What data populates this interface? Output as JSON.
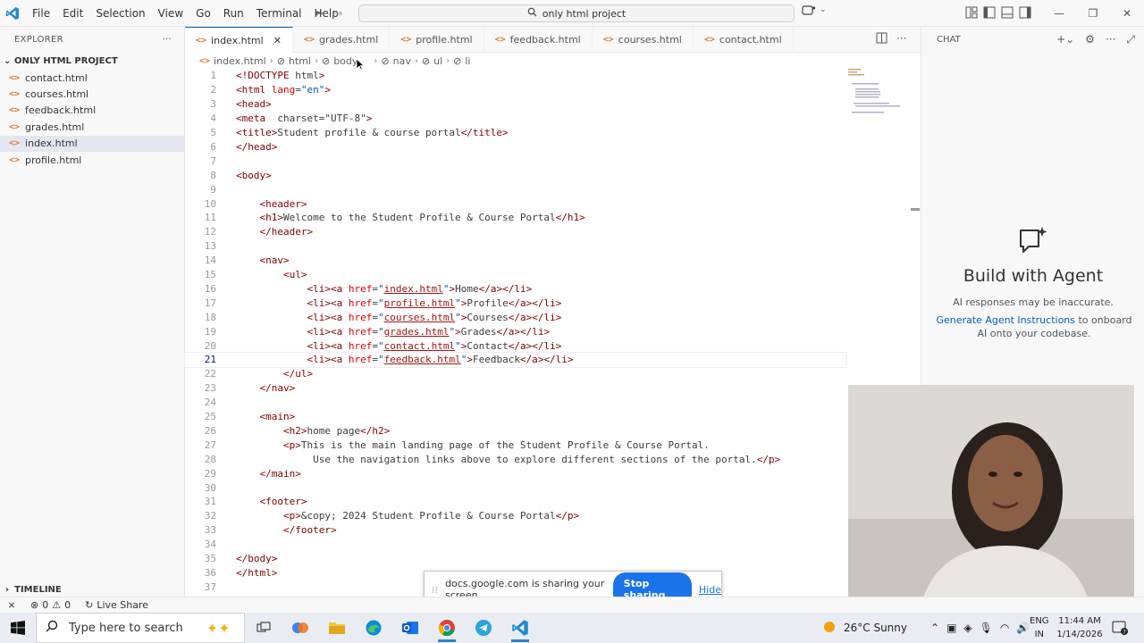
{
  "titlebar": {
    "menu": [
      "File",
      "Edit",
      "Selection",
      "View",
      "Go",
      "Run",
      "Terminal",
      "Help"
    ],
    "search": "only html project"
  },
  "explorer": {
    "header": "EXPLORER",
    "folder": "ONLY HTML PROJECT",
    "files": [
      "contact.html",
      "courses.html",
      "feedback.html",
      "grades.html",
      "index.html",
      "profile.html"
    ],
    "active_file": "index.html",
    "timeline": "TIMELINE"
  },
  "tabs": [
    {
      "label": "index.html",
      "active": true
    },
    {
      "label": "grades.html",
      "active": false
    },
    {
      "label": "profile.html",
      "active": false
    },
    {
      "label": "feedback.html",
      "active": false
    },
    {
      "label": "courses.html",
      "active": false
    },
    {
      "label": "contact.html",
      "active": false
    }
  ],
  "breadcrumb": [
    "index.html",
    "html",
    "body",
    "nav",
    "ul",
    "li"
  ],
  "code": {
    "current_line": 21,
    "lines": [
      "<!DOCTYPE html>",
      "<html lang=\"en\">",
      "<head>",
      "<meta  charset=\"UTF-8\">",
      "<title>Student profile & course portal</title>",
      "</head>",
      "",
      "<body>",
      "",
      "    <header>",
      "    <h1>Welcome to the Student Profile & Course Portal</h1>",
      "    </header>",
      "",
      "    <nav>",
      "        <ul>",
      "            <li><a href=\"index.html\">Home</a></li>",
      "            <li><a href=\"profile.html\">Profile</a></li>",
      "            <li><a href=\"courses.html\">Courses</a></li>",
      "            <li><a href=\"grades.html\">Grades</a></li>",
      "            <li><a href=\"contact.html\">Contact</a></li>",
      "            <li><a href=\"feedback.html\">Feedback</a></li>",
      "        </ul>",
      "    </nav>",
      "",
      "    <main>",
      "        <h2>home page</h2>",
      "        <p>This is the main landing page of the Student Profile & Course Portal.",
      "             Use the navigation links above to explore different sections of the portal.</p>",
      "    </main>",
      "",
      "    <footer>",
      "        <p>&copy; 2024 Student Profile & Course Portal</p>",
      "        </footer>",
      "",
      "</body>",
      "</html>",
      ""
    ]
  },
  "chat": {
    "header": "CHAT",
    "title": "Build with Agent",
    "note": "AI responses may be inaccurate.",
    "link": "Generate Agent Instructions",
    "help_suffix": " to onboard AI onto your codebase."
  },
  "share_banner": {
    "text": "docs.google.com is sharing your screen.",
    "stop": "Stop sharing",
    "hide": "Hide"
  },
  "statusbar": {
    "errors": "0",
    "warnings": "0",
    "live_share": "Live Share"
  },
  "taskbar": {
    "search_placeholder": "Type here to search",
    "weather": "26°C  Sunny",
    "lang_top": "ENG",
    "lang_bottom": "IN",
    "time": "11:44 AM",
    "date": "1/14/2026",
    "notifications": "7"
  },
  "colors": {
    "accent": "#005fb8",
    "html_icon": "#e37933",
    "stop_button": "#1a73e8"
  }
}
